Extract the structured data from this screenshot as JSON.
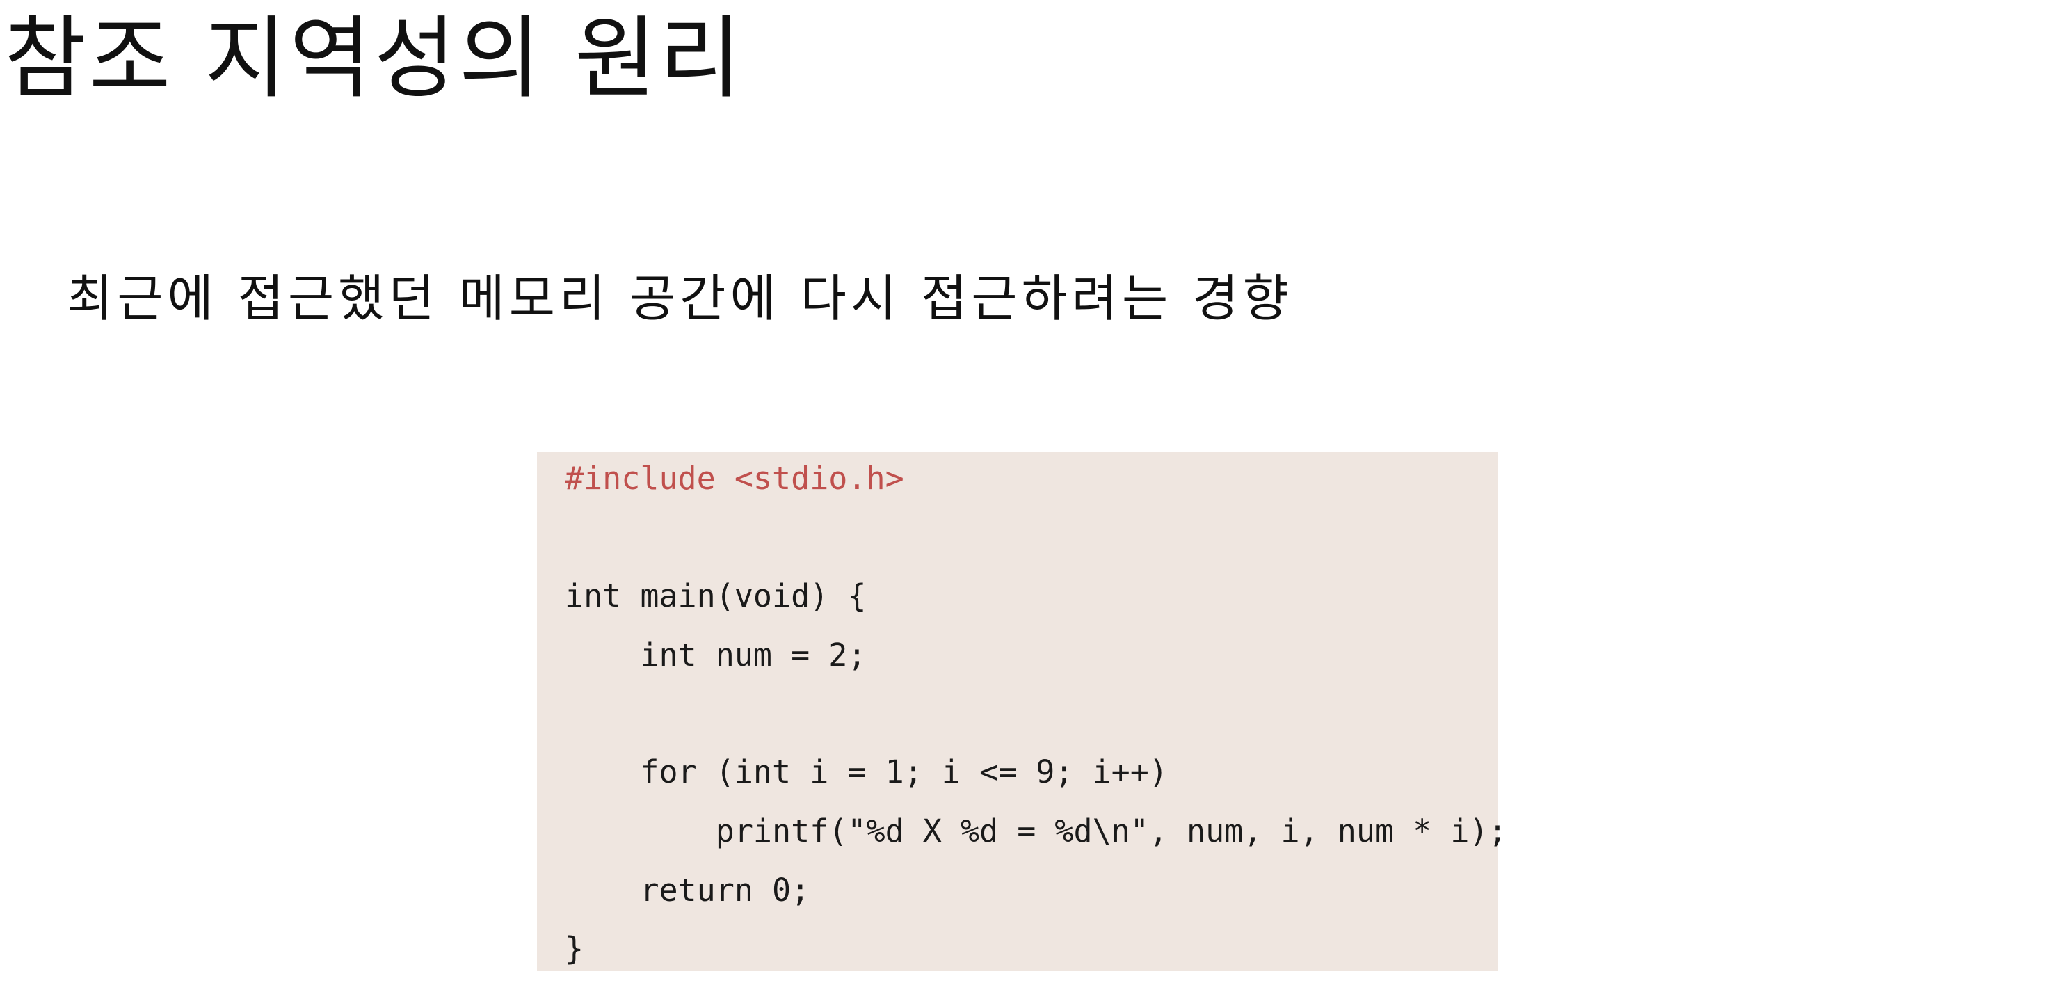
{
  "slide": {
    "title": "참조 지역성의 원리",
    "subtitle": "최근에 접근했던 메모리 공간에 다시 접근하려는 경향"
  },
  "code": {
    "include_color": "#c0504d",
    "background_color": "#efe6e0",
    "lines": [
      "#include <stdio.h>",
      "",
      "int main(void) {",
      "    int num = 2;",
      "",
      "    for (int i = 1; i <= 9; i++)",
      "        printf(\"%d X %d = %d\\n\", num, i, num * i);",
      "    return 0;",
      "}"
    ]
  }
}
